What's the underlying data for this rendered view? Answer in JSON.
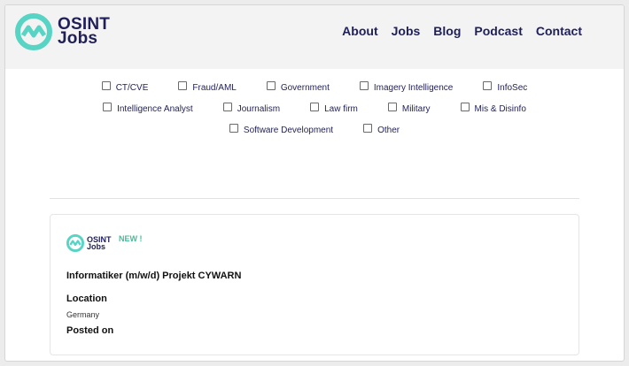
{
  "brand": {
    "line1": "OSINT",
    "line2": "Jobs",
    "accent_color": "#57d4c4",
    "text_color": "#1f1f5a"
  },
  "nav": [
    {
      "label": "About"
    },
    {
      "label": "Jobs"
    },
    {
      "label": "Blog"
    },
    {
      "label": "Podcast"
    },
    {
      "label": "Contact"
    }
  ],
  "filters": {
    "row1": [
      "CT/CVE",
      "Fraud/AML",
      "Government",
      "Imagery Intelligence",
      "InfoSec"
    ],
    "row2": [
      "Intelligence Analyst",
      "Journalism",
      "Law firm",
      "Military",
      "Mis & Disinfo"
    ],
    "row3": [
      "Software Development",
      "Other"
    ]
  },
  "job": {
    "brand_line1": "OSINT",
    "brand_line2": "Jobs",
    "badge": "NEW !",
    "badge_color": "#3fbf9a",
    "title": "Informatiker (m/w/d) Projekt CYWARN",
    "location_label": "Location",
    "location_value": "Germany",
    "posted_label": "Posted on"
  }
}
